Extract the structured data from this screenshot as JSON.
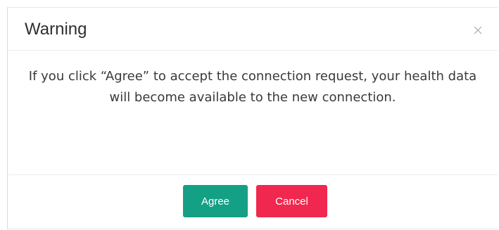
{
  "dialog": {
    "title": "Warning",
    "message": "If you click “Agree” to accept the connection request, your health data will become available to the new connection.",
    "close_icon": "close-icon",
    "buttons": {
      "agree_label": "Agree",
      "cancel_label": "Cancel"
    }
  },
  "colors": {
    "agree": "#14a085",
    "cancel": "#f0284f"
  }
}
